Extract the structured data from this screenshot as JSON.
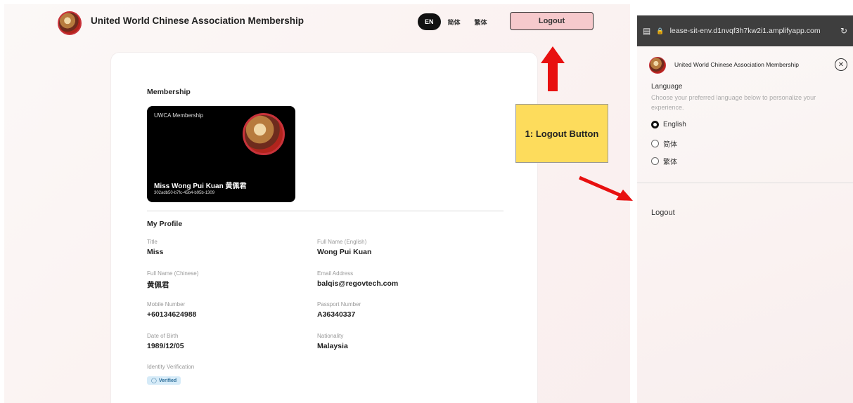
{
  "header": {
    "app_title": "United World Chinese Association Membership",
    "languages": [
      "EN",
      "简体",
      "繁体"
    ],
    "logout_label": "Logout"
  },
  "membership": {
    "section_title": "Membership",
    "card_label": "UWCA Membership",
    "holder_name": "Miss Wong Pui Kuan 黄佩君",
    "member_id": "302adb50-b7fc-45b4-b95b-1309"
  },
  "profile": {
    "section_title": "My Profile",
    "fields": [
      {
        "label": "Title",
        "value": "Miss"
      },
      {
        "label": "Full Name (English)",
        "value": "Wong Pui Kuan"
      },
      {
        "label": "Full Name (Chinese)",
        "value": "黄佩君"
      },
      {
        "label": "Email Address",
        "value": "balqis@regovtech.com"
      },
      {
        "label": "Mobile Number",
        "value": "+60134624988"
      },
      {
        "label": "Passport Number",
        "value": "A36340337"
      },
      {
        "label": "Date of Birth",
        "value": "1989/12/05"
      },
      {
        "label": "Nationality",
        "value": "Malaysia"
      }
    ],
    "identity_label": "Identity Verification",
    "verified_label": "Verified"
  },
  "annotation": {
    "box_text": "1: Logout Button",
    "color": "#fddc5c",
    "arrow_color": "#e81010"
  },
  "mobile": {
    "url": "lease-sit-env.d1nvqf3h7kw2i1.amplifyapp.com",
    "app_title": "United World Chinese Association Membership",
    "language_title": "Language",
    "language_desc": "Choose your preferred language below to personalize your experience.",
    "options": [
      "English",
      "简体",
      "繁体"
    ],
    "selected_option": "English",
    "logout_label": "Logout"
  },
  "colors": {
    "accent_logout": "#f6c9cc",
    "badge_bg": "#d6ebf8",
    "card_bg": "#000000"
  }
}
